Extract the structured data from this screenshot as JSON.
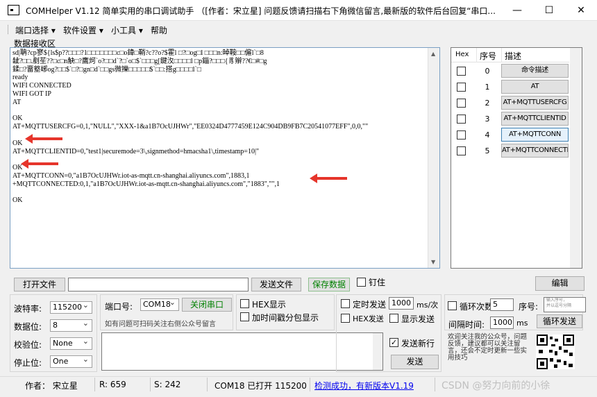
{
  "window": {
    "title": "COMHelper V1.12 简单实用的串口调试助手  （[作者：宋立星] 问题反馈请扫描右下角微信留言,最新版的软件后台回复“串口...",
    "minimize": "—",
    "maximize": "☐",
    "close": "✕"
  },
  "menu": [
    {
      "label": "端口选择 ▾"
    },
    {
      "label": "软件设置 ▾"
    },
    {
      "label": "小工具 ▾"
    },
    {
      "label": "帮助"
    }
  ],
  "receive": {
    "label": "数据接收区",
    "lines": [
      "sd|聃?cp寥${ls$p??□□□?1□□□□□□□c□o鍏□鞘?c??o?$霍l □?□og□l □□□n:晫鞍□□僱l`□8",
      "龇?□□.剷苼??□c□n觖□?鷹炣`o?□□d`?□`o□$`□□□g[鍵汷□□□□l □p錙?□□□{豸辮??€□#□g",
      "鍒□?畱墪峫og?□□$`□?□gn□d`□□gs微擽□□□□□$`□□:搭g□□□□l`□",
      "ready",
      "WIFI CONNECTED",
      "WIFI GOT IP",
      "AT",
      "",
      "OK",
      "AT+MQTTUSERCFG=0,1,\"NULL\",\"XXX-1&a1B7OcUJHWr\",\"EE0324D4777459E124C904DB9FB7C20541077EFF\",0,0,\"\"",
      "",
      "OK",
      "AT+MQTTCLIENTID=0,\"test1|securemode=3\\,signmethod=hmacsha1\\,timestamp=10|\"",
      "",
      "OK",
      "AT+MQTTCONN=0,\"a1B7OcUJHWr.iot-as-mqtt.cn-shanghai.aliyuncs.com\",1883,1",
      "+MQTTCONNECTED:0,1,\"a1B7OcUJHWr.iot-as-mqtt.cn-shanghai.aliyuncs.com\",\"1883\",\"\",1",
      "",
      "OK"
    ]
  },
  "commands": {
    "headers": [
      "Hex",
      "序号",
      "描述"
    ],
    "rows": [
      {
        "index": "0",
        "desc": "命令描述"
      },
      {
        "index": "1",
        "desc": "AT"
      },
      {
        "index": "2",
        "desc": "AT+MQTTUSERCFG"
      },
      {
        "index": "3",
        "desc": "AT+MQTTCLIENTID"
      },
      {
        "index": "4",
        "desc": "AT+MQTTCONN"
      },
      {
        "index": "5",
        "desc": "AT+MQTTCONNECTED"
      }
    ]
  },
  "file": {
    "open_button": "打开文件",
    "path_value": "",
    "send_file_button": "发送文件",
    "save_data_button": "保存数据",
    "pin_label": "钉住",
    "edit_button": "编辑"
  },
  "serial": {
    "baud_label": "波特率:",
    "baud_value": "115200",
    "databits_label": "数据位:",
    "databits_value": "8",
    "parity_label": "校验位:",
    "parity_value": "None",
    "stopbits_label": "停止位:",
    "stopbits_value": "One",
    "port_label": "端口号:",
    "port_value": "COM18",
    "close_port_button": "关闭串口",
    "hint": "如有问题可扫码关注右侧公众号留言"
  },
  "options": {
    "hex_display": "HEX显示",
    "timestamp_split": "加时间戳分包显示",
    "timed_send": "定时发送",
    "timed_value": "1000",
    "timed_unit": "ms/次",
    "hex_send": "HEX发送",
    "show_send": "显示发送",
    "send_newline": "发送新行",
    "send_button": "发送",
    "send_text": ""
  },
  "loop": {
    "loop_count_label": "循环次数",
    "loop_count_value": "5",
    "seq_label": "序号:",
    "seq_placeholder": "输入序号，\n并以逗号分隔",
    "interval_label": "间隔时间:",
    "interval_value": "1000",
    "interval_unit": "ms",
    "loop_send_button": "循环发送",
    "promo_text": "欢迎关注我的公众号，问题反馈，建议都可以关注留言，还会不定时更新一些实用技巧"
  },
  "status": {
    "author": "作者： 宋立星",
    "rx": "R:  659",
    "tx": "S:  242",
    "port_state": "COM18 已打开 115200",
    "update_link": "检测成功，有新版本V1.19",
    "watermark": "CSDN @努力向前的小徐"
  },
  "colors": {
    "arrow": "#e6352b",
    "save_text": "#008000",
    "close_port_text": "#008000",
    "link": "#0000ee",
    "selected_border": "#3c7fb1"
  }
}
